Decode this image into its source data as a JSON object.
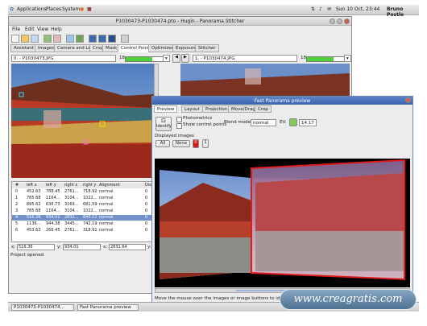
{
  "panel": {
    "menus": [
      "Applications",
      "Places",
      "System"
    ],
    "clock": "Sun 10 Oct, 23:44",
    "user": "Bruno Postle"
  },
  "main": {
    "title": "P1030473-P1030474.pto - Hugin - Panorama Stitcher",
    "menu": [
      "File",
      "Edit",
      "View",
      "Help"
    ],
    "tabs": [
      "Assistant",
      "Images",
      "Camera and Lens",
      "Crop",
      "Mask",
      "Control Points",
      "Optimizer",
      "Exposure",
      "Stitcher"
    ],
    "left_combo": "0. - P1030473.JPG",
    "left_num": "18",
    "left_level": 0.72,
    "right_combo": "1. - P1030474.JPG",
    "right_num": "18",
    "right_level": 0.72,
    "table_headers": [
      "#",
      "left x",
      "left y",
      "right x",
      "right y",
      "Alignment",
      "Dista"
    ],
    "rows": [
      [
        "0",
        "452.63",
        "788.45",
        "2761...",
        "718.92",
        "normal",
        "0"
      ],
      [
        "1",
        "785.68",
        "1164...",
        "3104...",
        "1022...",
        "normal",
        "0"
      ],
      [
        "2",
        "895.62",
        "636.73",
        "3169...",
        "681.59",
        "normal",
        "0"
      ],
      [
        "3",
        "785.68",
        "1164...",
        "3104...",
        "1022...",
        "normal",
        "0"
      ],
      [
        "4",
        "516.36",
        "934.01",
        "2831...",
        "840.12",
        "normal",
        "0"
      ],
      [
        "5",
        "1136...",
        "944.38",
        "3445...",
        "742.19",
        "normal",
        "0"
      ],
      [
        "6",
        "453.63",
        "266.45",
        "2761...",
        "318.91",
        "normal",
        "0"
      ]
    ],
    "edit_x_label": "x:",
    "edit_x": "516.36",
    "edit_y_label": "y:",
    "edit_y": "934.01",
    "edit_x2_label": "x:",
    "edit_x2": "2831.64",
    "edit_y2_label": "y:",
    "status": "Project opened"
  },
  "fast_preview": {
    "title": "Fast Panorama preview",
    "tabs": [
      "Preview",
      "Layout",
      "Projection",
      "Move/Drag",
      "Crop"
    ],
    "identify": "Identify",
    "photometrics": "Photometrics",
    "show_cp": "Show control points",
    "blend_label": "Blend mode:",
    "blend_value": "normal",
    "ev_label": "EV:",
    "ev_value": "14.17",
    "displayed": "Displayed images",
    "all": "All",
    "none": "None",
    "num0": "0",
    "num1": "1",
    "hint": "Move the mouse over the images or image buttons to identify them"
  },
  "taskbar": {
    "items": [
      "P1030473-P1030474...",
      "Fast Panorama preview"
    ]
  },
  "watermark": "www.creagratis.com"
}
